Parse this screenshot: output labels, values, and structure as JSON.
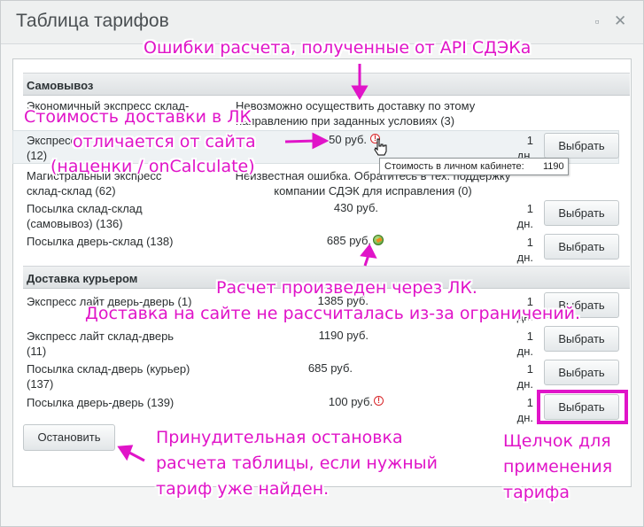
{
  "window": {
    "title": "Таблица тарифов",
    "minimize_icon": "minimize-icon",
    "close_icon": "close-icon"
  },
  "sections": [
    {
      "label": "Самовывоз"
    },
    {
      "label": "Доставка курьером"
    }
  ],
  "rows": [
    {
      "name": "Экономичный экспресс склад-склад (234)",
      "name_line1": "Экономичный экспресс склад-",
      "name_line2": "",
      "error": "Невозможно осуществить доставку по этому направлению при заданных условиях (3)",
      "error_line1": "Невозможно осуществить доставку по этому",
      "error_line2": "направлению при заданных условиях (3)"
    },
    {
      "name_line1": "Экспресс",
      "name_line2": "(12)",
      "price": "50 руб.",
      "days": "1 дн.",
      "days_line1": "1",
      "days_line2": "дн.",
      "button": "Выбрать",
      "status_icon": "error-icon"
    },
    {
      "name_line1": "Магистральный экспресс",
      "name_line2": "склад-склад (62)",
      "error_line1": "Неизвестная ошибка. Обратитесь в тех. поддержку",
      "error_line2": "компании СДЭК для исправления (0)"
    },
    {
      "name_line1": "Посылка склад-склад",
      "name_line2": "(самовывоз) (136)",
      "price": "430 руб.",
      "days_line1": "1",
      "days_line2": "дн.",
      "button": "Выбрать"
    },
    {
      "name_line1": "Посылка дверь-склад (138)",
      "price": "685 руб.",
      "days_line1": "1",
      "days_line2": "дн.",
      "button": "Выбрать",
      "status_icon": "ok-icon"
    },
    {
      "name_line1": "Экспресс лайт дверь-дверь (1)",
      "price": "1385 руб.",
      "days_line1": "1",
      "days_line2": "дн.",
      "button": "Выбрать"
    },
    {
      "name_line1": "Экспресс лайт склад-дверь",
      "name_line2": "(11)",
      "price": "1190 руб.",
      "days_line1": "1",
      "days_line2": "дн.",
      "button": "Выбрать"
    },
    {
      "name_line1": "Посылка склад-дверь (курьер)",
      "name_line2": "(137)",
      "price": "685 руб.",
      "days_line1": "1",
      "days_line2": "дн.",
      "button": "Выбрать"
    },
    {
      "name_line1": "Посылка дверь-дверь (139)",
      "price": "100 руб.",
      "days_line1": "1",
      "days_line2": "дн.",
      "button": "Выбрать",
      "status_icon": "error-icon"
    }
  ],
  "tooltip": {
    "label": "Стоимость в личном кабинете:",
    "value": "1190"
  },
  "stop_button": "Остановить",
  "annotations": {
    "api_errors": "Ошибки расчета, полученные от API СДЭКа",
    "lk_cost_1": "Стоимость доставки в ЛК",
    "lk_cost_2": "отличается от сайта",
    "lk_cost_3": "(наценки / onCalculate)",
    "via_lk_1": "Расчет произведен через ЛК.",
    "via_lk_2": "Доставка на сайте не рассчиталась из-за ограничений.",
    "stop_1": "Принудительная остановка",
    "stop_2": "расчета таблицы, если нужный",
    "stop_3": "тариф уже найден.",
    "click_1": "Щелчок для",
    "click_2": "применения",
    "click_3": "тарифа"
  },
  "colors": {
    "annotation": "#e014c8",
    "error": "#d8262a",
    "ok": "#4f9a2c"
  }
}
